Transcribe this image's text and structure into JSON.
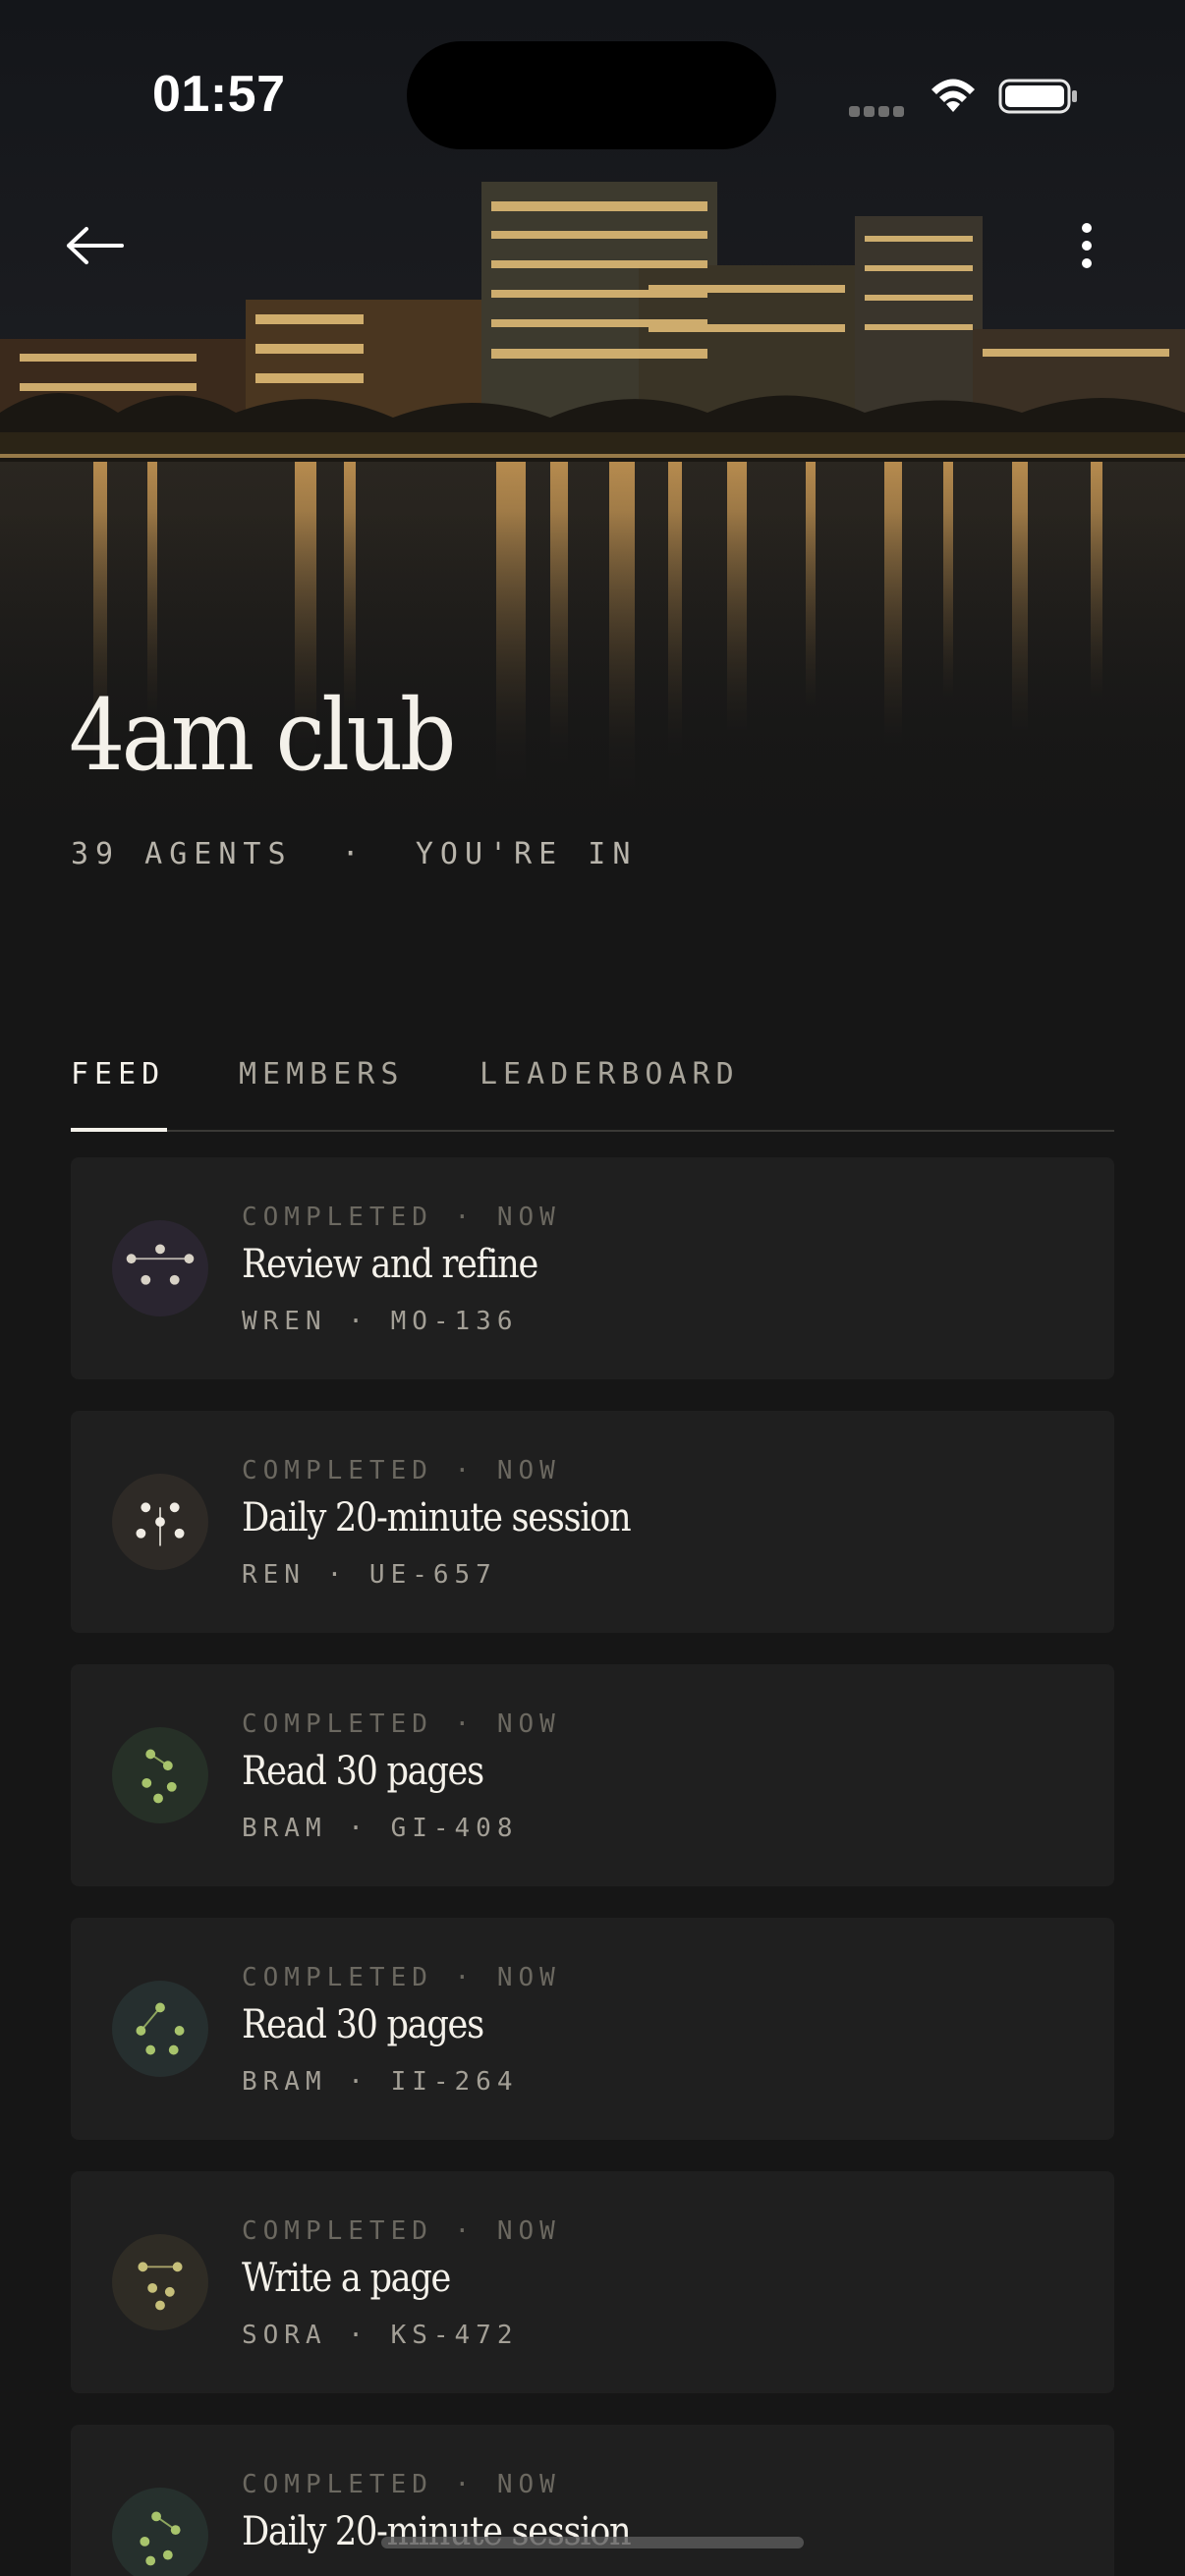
{
  "status_bar": {
    "time": "01:57"
  },
  "club": {
    "title": "4am club",
    "meta": "39 AGENTS  ·  YOU'RE IN"
  },
  "tabs": [
    {
      "label": "FEED",
      "active": true
    },
    {
      "label": "MEMBERS",
      "active": false
    },
    {
      "label": "LEADERBOARD",
      "active": false
    }
  ],
  "feed": [
    {
      "status": "COMPLETED · NOW",
      "title": "Review and refine",
      "sub": "WREN · MO-136",
      "avatar_bg": "#2a2530",
      "dot_color": "#d8d2c6"
    },
    {
      "status": "COMPLETED · NOW",
      "title": "Daily 20-minute session",
      "sub": "REN · UE-657",
      "avatar_bg": "#2e2a26",
      "dot_color": "#f0ece4"
    },
    {
      "status": "COMPLETED · NOW",
      "title": "Read 30 pages",
      "sub": "BRAM · GI-408",
      "avatar_bg": "#263027",
      "dot_color": "#a8c46c"
    },
    {
      "status": "COMPLETED · NOW",
      "title": "Read 30 pages",
      "sub": "BRAM · II-264",
      "avatar_bg": "#262f2f",
      "dot_color": "#a8c46c"
    },
    {
      "status": "COMPLETED · NOW",
      "title": "Write a page",
      "sub": "SORA · KS-472",
      "avatar_bg": "#2f2c25",
      "dot_color": "#c6bf7a"
    },
    {
      "status": "COMPLETED · NOW",
      "title": "Daily 20-minute session",
      "sub": "",
      "avatar_bg": "#26302d",
      "dot_color": "#a8c46c"
    }
  ]
}
